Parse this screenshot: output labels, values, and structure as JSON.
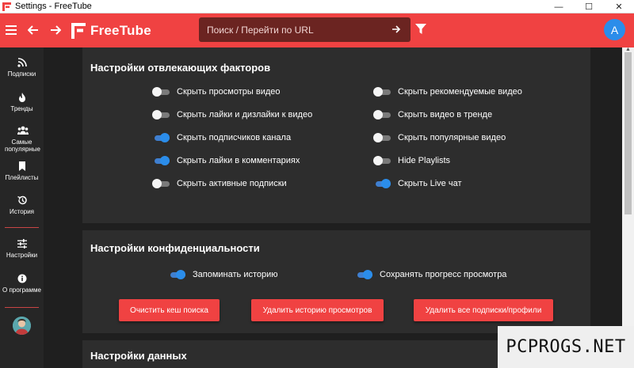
{
  "window": {
    "title": "Settings - FreeTube",
    "minimize": "—",
    "maximize": "☐",
    "close": "✕"
  },
  "topbar": {
    "brand": "FreeTube",
    "search_placeholder": "Поиск / Перейти по URL",
    "avatar_letter": "A"
  },
  "sidebar": {
    "items": [
      {
        "label": "Подписки",
        "icon": "rss-icon"
      },
      {
        "label": "Тренды",
        "icon": "fire-icon"
      },
      {
        "label": "Самые популярные",
        "icon": "users-icon"
      },
      {
        "label": "Плейлисты",
        "icon": "bookmark-icon"
      },
      {
        "label": "История",
        "icon": "history-icon"
      },
      {
        "label": "Настройки",
        "icon": "sliders-icon"
      },
      {
        "label": "О программе",
        "icon": "info-icon"
      }
    ]
  },
  "distraction": {
    "title": "Настройки отвлекающих факторов",
    "left": [
      {
        "label": "Скрыть просмотры видео",
        "on": false
      },
      {
        "label": "Скрыть лайки и дизлайки к видео",
        "on": false
      },
      {
        "label": "Скрыть подписчиков канала",
        "on": true
      },
      {
        "label": "Скрыть лайки в комментариях",
        "on": true
      },
      {
        "label": "Скрыть активные подписки",
        "on": false
      }
    ],
    "right": [
      {
        "label": "Скрыть рекомендуемые видео",
        "on": false
      },
      {
        "label": "Скрыть видео в тренде",
        "on": false
      },
      {
        "label": "Скрыть популярные видео",
        "on": false
      },
      {
        "label": "Hide Playlists",
        "on": false
      },
      {
        "label": "Скрыть Live чат",
        "on": true
      }
    ]
  },
  "privacy": {
    "title": "Настройки конфиденциальности",
    "toggles": [
      {
        "label": "Запоминать историю",
        "on": true
      },
      {
        "label": "Сохранять прогресс просмотра",
        "on": true
      }
    ],
    "buttons": [
      "Очистить кеш поиска",
      "Удалить историю просмотров",
      "Удалить все подписки/профили"
    ]
  },
  "data": {
    "title": "Настройки данных"
  },
  "watermark": "PCPROGS.NET",
  "colors": {
    "accent": "#f04242",
    "toggle_on": "#2b8dea",
    "panel": "#2d2d2d"
  }
}
